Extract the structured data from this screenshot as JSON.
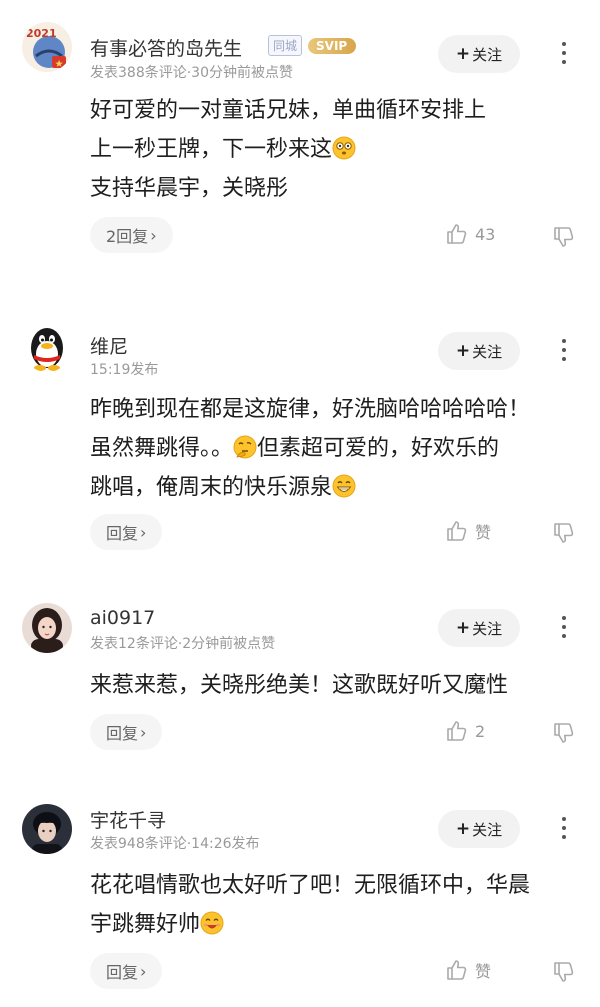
{
  "comments": [
    {
      "username": "有事必答的岛先生",
      "badge_city": "同城",
      "badge_vip": "SVIP",
      "avatar_text": "2021",
      "meta": "发表388条评论·30分钟前被点赞",
      "follow_label": "关注",
      "lines": [
        "好可爱的一对童话兄妹，单曲循环安排上",
        "上一秒王牌，下一秒来这",
        "支持华晨宇，关晓彤"
      ],
      "reply_label": "2回复",
      "like_count": "43"
    },
    {
      "username": "维尼",
      "meta": "15:19发布",
      "follow_label": "关注",
      "lines": [
        "昨晚到现在都是这旋律，好洗脑哈哈哈哈哈！",
        "虽然舞跳得。。",
        "但素超可爱的，好欢乐的",
        "跳唱，俺周末的快乐源泉"
      ],
      "reply_label": "回复",
      "like_count": "赞"
    },
    {
      "username": "ai0917",
      "meta": "发表12条评论·2分钟前被点赞",
      "follow_label": "关注",
      "lines": [
        "来惹来惹，关晓彤绝美！这歌既好听又魔性"
      ],
      "reply_label": "回复",
      "like_count": "2"
    },
    {
      "username": "宇花千寻",
      "meta": "发表948条评论·14:26发布",
      "follow_label": "关注",
      "lines": [
        "花花唱情歌也太好听了吧！无限循环中，华晨",
        "宇跳舞好帅"
      ],
      "reply_label": "回复",
      "like_count": "赞"
    }
  ],
  "icons": {
    "follow": "plus-icon",
    "more": "more-vertical-icon",
    "reply_arrow": "chevron-right-icon",
    "like": "thumbs-up-icon",
    "dislike": "thumbs-down-icon",
    "emoji_1": "dizzy-face-emoji",
    "emoji_2": "thinking-face-emoji",
    "emoji_3": "grinning-face-emoji",
    "emoji_4": "smiling-face-emoji"
  },
  "colors": {
    "svip": "#d8a64a",
    "badge_city": "#9aa5c9",
    "meta": "#999999",
    "follow_bg": "#f2f2f2"
  }
}
